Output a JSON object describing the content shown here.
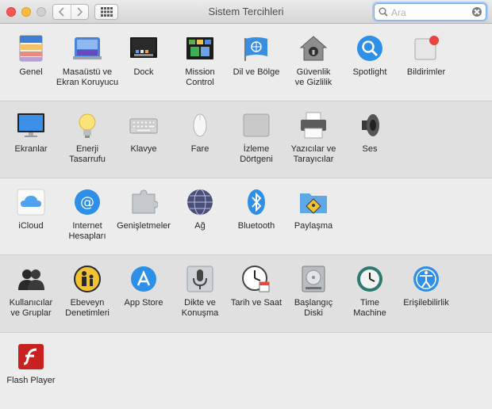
{
  "window": {
    "title": "Sistem Tercihleri"
  },
  "toolbar": {
    "back_icon": "chevron-left",
    "forward_icon": "chevron-right",
    "grid_icon": "grid"
  },
  "search": {
    "placeholder": "Ara"
  },
  "sections": [
    {
      "items": [
        {
          "label": "Genel",
          "icon": "general-icon"
        },
        {
          "label": "Masaüstü ve\nEkran Koruyucu",
          "icon": "desktop-icon"
        },
        {
          "label": "Dock",
          "icon": "dock-icon"
        },
        {
          "label": "Mission\nControl",
          "icon": "mission-control-icon"
        },
        {
          "label": "Dil ve Bölge",
          "icon": "flag-icon"
        },
        {
          "label": "Güvenlik\nve Gizlilik",
          "icon": "house-icon"
        },
        {
          "label": "Spotlight",
          "icon": "spotlight-icon"
        },
        {
          "label": "Bildirimler",
          "icon": "notifications-icon"
        }
      ]
    },
    {
      "items": [
        {
          "label": "Ekranlar",
          "icon": "display-icon"
        },
        {
          "label": "Enerji\nTasarrufu",
          "icon": "bulb-icon"
        },
        {
          "label": "Klavye",
          "icon": "keyboard-icon"
        },
        {
          "label": "Fare",
          "icon": "mouse-icon"
        },
        {
          "label": "İzleme\nDörtgeni",
          "icon": "trackpad-icon"
        },
        {
          "label": "Yazıcılar ve\nTarayıcılar",
          "icon": "printer-icon"
        },
        {
          "label": "Ses",
          "icon": "speaker-icon"
        }
      ]
    },
    {
      "items": [
        {
          "label": "iCloud",
          "icon": "icloud-icon"
        },
        {
          "label": "Internet\nHesapları",
          "icon": "at-icon"
        },
        {
          "label": "Genişletmeler",
          "icon": "puzzle-icon"
        },
        {
          "label": "Ağ",
          "icon": "globe-icon"
        },
        {
          "label": "Bluetooth",
          "icon": "bluetooth-icon"
        },
        {
          "label": "Paylaşma",
          "icon": "sharing-folder-icon"
        }
      ]
    },
    {
      "items": [
        {
          "label": "Kullanıcılar\nve Gruplar",
          "icon": "users-icon"
        },
        {
          "label": "Ebeveyn\nDenetimleri",
          "icon": "parental-icon"
        },
        {
          "label": "App Store",
          "icon": "appstore-icon"
        },
        {
          "label": "Dikte ve\nKonuşma",
          "icon": "microphone-icon"
        },
        {
          "label": "Tarih ve Saat",
          "icon": "clock-icon"
        },
        {
          "label": "Başlangıç\nDiski",
          "icon": "disk-icon"
        },
        {
          "label": "Time\nMachine",
          "icon": "time-machine-icon"
        },
        {
          "label": "Erişilebilirlik",
          "icon": "accessibility-icon"
        }
      ]
    },
    {
      "items": [
        {
          "label": "Flash Player",
          "icon": "flash-icon"
        }
      ]
    }
  ]
}
